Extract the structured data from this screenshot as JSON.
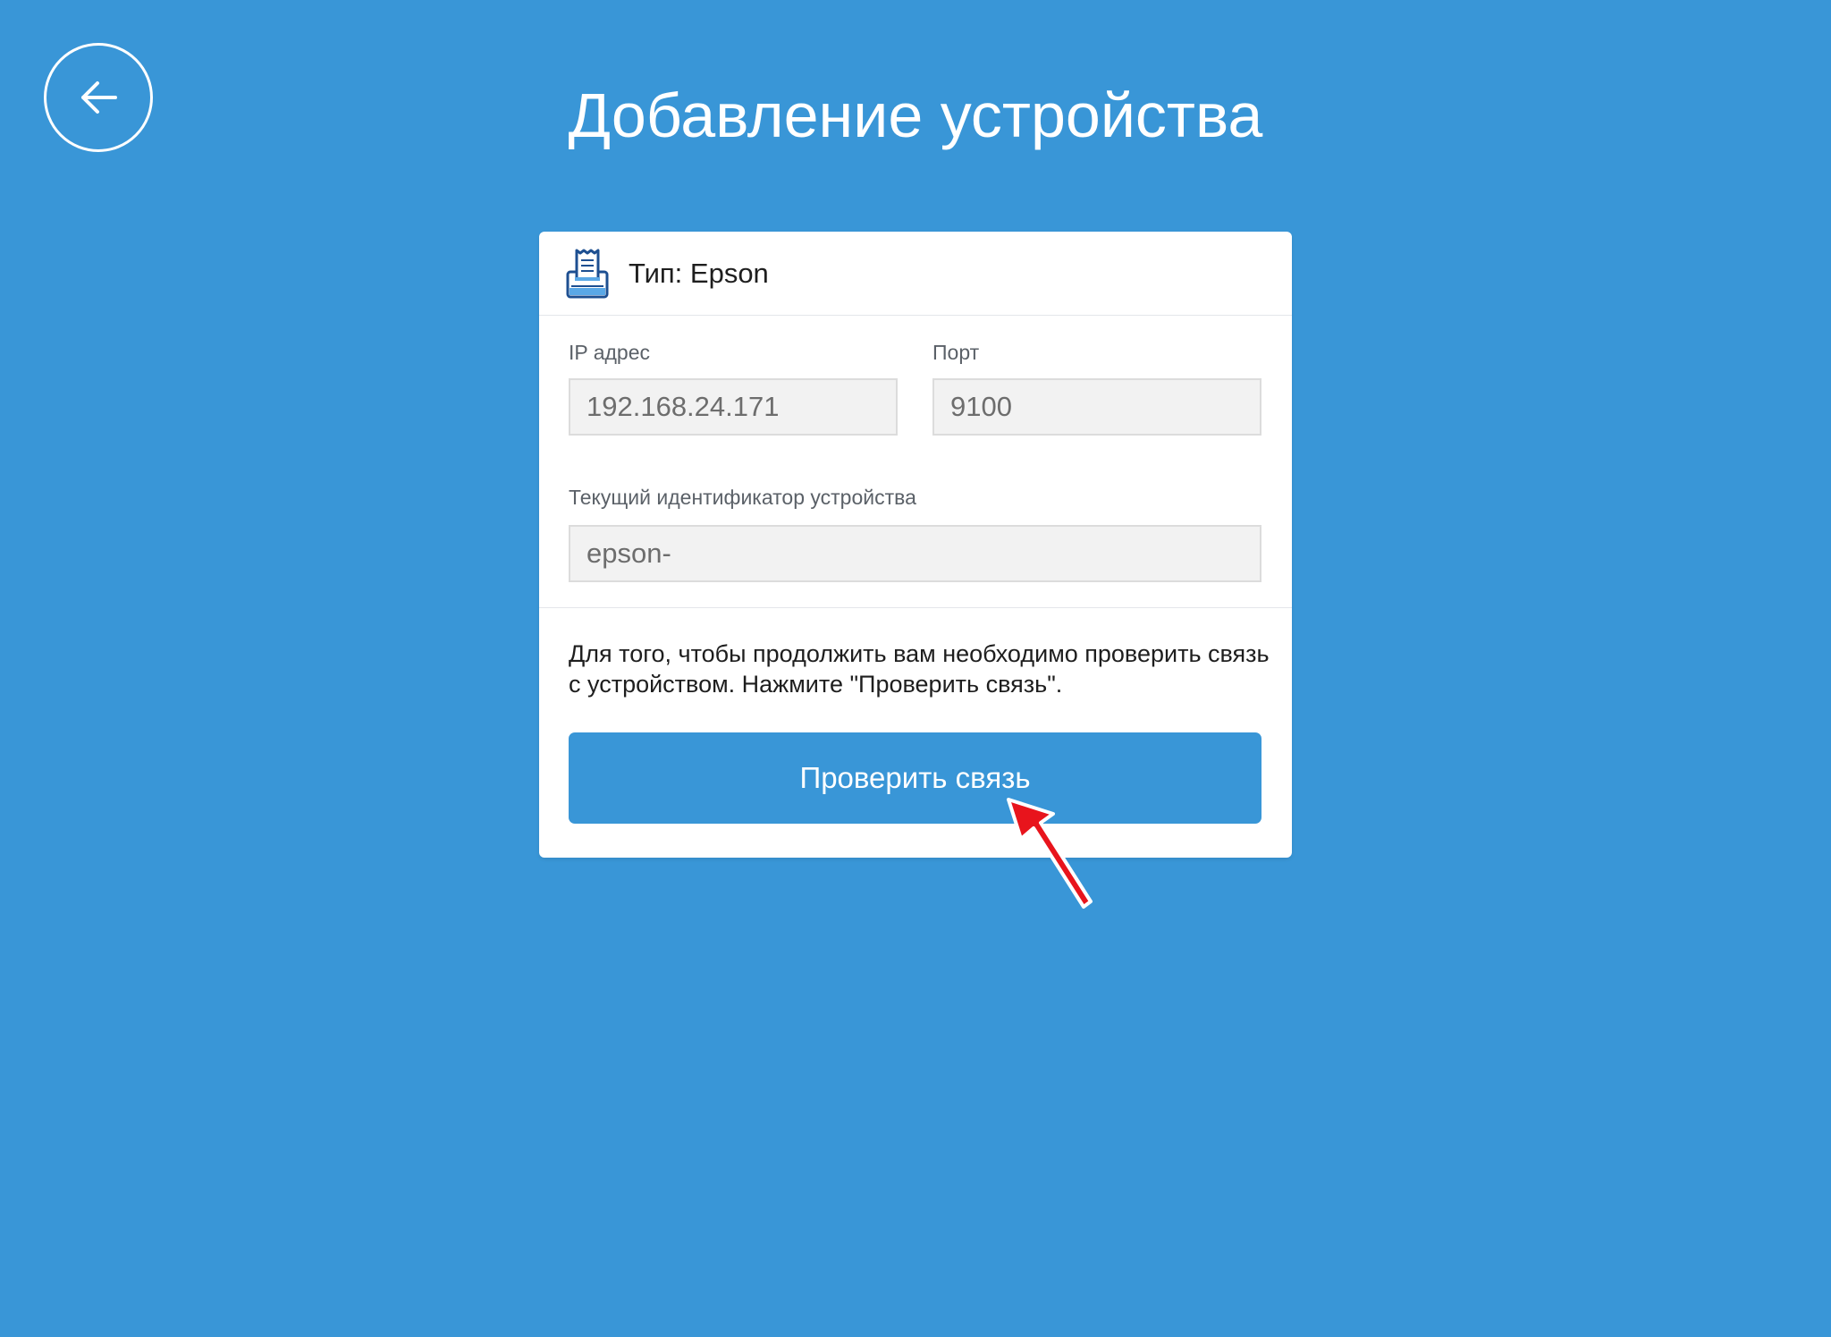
{
  "header": {
    "title": "Добавление устройства",
    "back_icon": "arrow-left-icon"
  },
  "device_card": {
    "type_icon": "receipt-printer-icon",
    "type_label": "Тип: Epson",
    "fields": {
      "ip": {
        "label": "IP адрес",
        "value": "192.168.24.171"
      },
      "port": {
        "label": "Порт",
        "value": "9100"
      },
      "device_id": {
        "label": "Текущий идентификатор устройства",
        "value": "epson-"
      }
    },
    "info_text": "Для того, чтобы продолжить вам необходимо проверить связь с устройством. Нажмите \"Проверить связь\".",
    "check_button_label": "Проверить связь"
  },
  "colors": {
    "background": "#3996d7",
    "card": "#ffffff",
    "button": "#3996d7",
    "annotation_arrow": "#e8141c"
  }
}
